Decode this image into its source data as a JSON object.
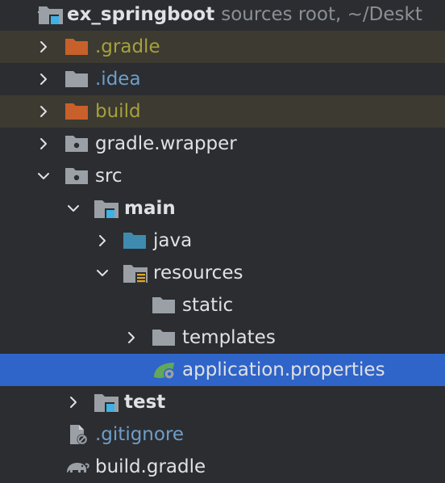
{
  "colors": {
    "background": "#2b2d30",
    "excluded_row": "#3d3a31",
    "selected_row": "#2f64c9",
    "folder_gray": "#9aa0a6",
    "folder_orange": "#c8602b",
    "folder_java": "#3f8bb0",
    "module_badge": "#3fb1e5",
    "resources_badge": "#e0a72b",
    "spring_green": "#62a85a",
    "excluded_text": "#a5a13d",
    "ignored_text": "#6f9ec9",
    "text": "#dfe1e5",
    "hint_text": "#8c8f94"
  },
  "tree": {
    "root": {
      "name": "ex_springboot",
      "hint": "sources root, ~/Deskt",
      "icon": "module-folder-icon"
    },
    "gradle_dir": {
      "name": ".gradle",
      "icon": "excluded-folder-icon"
    },
    "idea_dir": {
      "name": ".idea",
      "icon": "folder-icon"
    },
    "build_dir": {
      "name": "build",
      "icon": "excluded-folder-icon"
    },
    "gradle_wrapper": {
      "name": "gradle.wrapper",
      "icon": "package-folder-icon"
    },
    "src": {
      "name": "src",
      "icon": "package-folder-icon"
    },
    "main": {
      "name": "main",
      "icon": "module-folder-icon"
    },
    "java": {
      "name": "java",
      "icon": "source-root-folder-icon"
    },
    "resources": {
      "name": "resources",
      "icon": "resources-folder-icon"
    },
    "static": {
      "name": "static",
      "icon": "folder-icon"
    },
    "templates": {
      "name": "templates",
      "icon": "folder-icon"
    },
    "application_properties": {
      "name": "application.properties",
      "icon": "spring-leaf-icon"
    },
    "test": {
      "name": "test",
      "icon": "module-folder-icon"
    },
    "gitignore": {
      "name": ".gitignore",
      "icon": "ignored-file-icon"
    },
    "build_gradle": {
      "name": "build.gradle",
      "icon": "gradle-elephant-icon"
    }
  }
}
